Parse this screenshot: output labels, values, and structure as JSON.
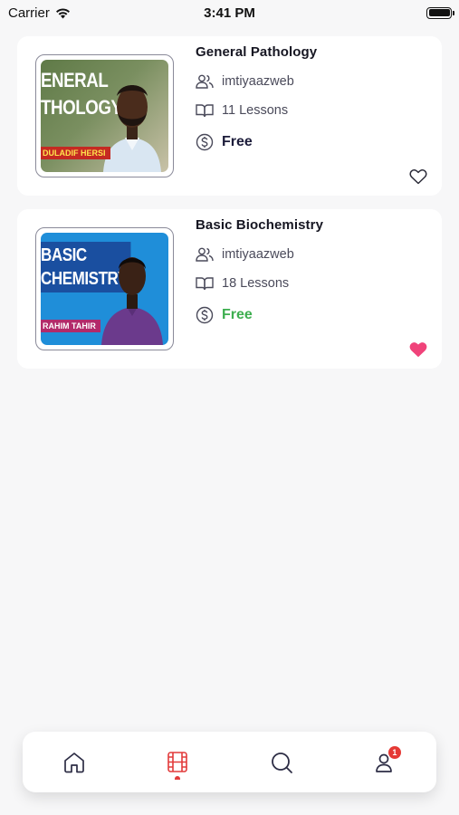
{
  "status_bar": {
    "carrier": "Carrier",
    "time": "3:41 PM"
  },
  "courses": [
    {
      "title": "General Pathology",
      "author": "imtiyaazweb",
      "lessons": "11 Lessons",
      "price": "Free",
      "price_color": "#1c1c3a",
      "favorited": false,
      "thumbnail": {
        "title": "ENERAL\nTHOLOGY",
        "name": "DULADIF HERSI"
      }
    },
    {
      "title": "Basic Biochemistry",
      "author": "imtiyaazweb",
      "lessons": "18 Lessons",
      "price": "Free",
      "price_color": "#3dae4f",
      "favorited": true,
      "thumbnail": {
        "title": "BASIC\nCHEMISTRY",
        "name": "RAHIM TAHIR"
      }
    }
  ],
  "bottom_nav": {
    "items": [
      {
        "name": "home",
        "icon": "home-icon",
        "active": false
      },
      {
        "name": "courses",
        "icon": "film-icon",
        "active": true
      },
      {
        "name": "search",
        "icon": "search-icon",
        "active": false
      },
      {
        "name": "profile",
        "icon": "user-icon",
        "active": false,
        "badge": "1"
      }
    ],
    "active_color": "#e23b3b",
    "inactive_color": "#2d2d45"
  }
}
